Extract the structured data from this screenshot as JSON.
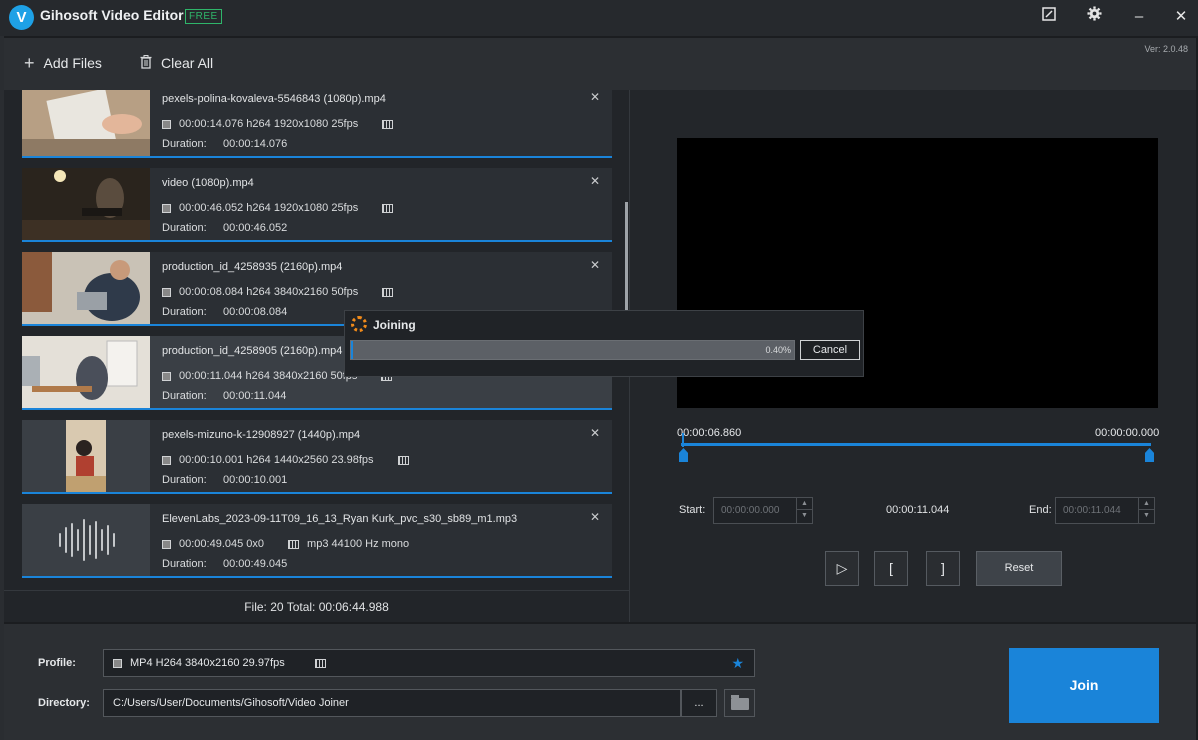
{
  "app": {
    "title": "Gihosoft Video Editor",
    "badge": "FREE",
    "logo": "V"
  },
  "window": {
    "edit_icon": "edit-icon",
    "settings_icon": "gear-icon",
    "minimize": "–",
    "close": "✕"
  },
  "toolbar": {
    "add_files": "Add Files",
    "clear_all": "Clear All",
    "version": "Ver: 2.0.48"
  },
  "files": [
    {
      "name": "pexels-polina-kovaleva-5546843 (1080p).mp4",
      "time": "00:00:14.076",
      "video": "h264 1920x1080 25fps",
      "duration_label": "Duration:",
      "duration": "00:00:14.076",
      "selected": false
    },
    {
      "name": "video (1080p).mp4",
      "time": "00:00:46.052",
      "video": "h264 1920x1080 25fps",
      "duration_label": "Duration:",
      "duration": "00:00:46.052",
      "selected": false
    },
    {
      "name": "production_id_4258935 (2160p).mp4",
      "time": "00:00:08.084",
      "video": "h264 3840x2160 50fps",
      "duration_label": "Duration:",
      "duration": "00:00:08.084",
      "selected": false
    },
    {
      "name": "production_id_4258905 (2160p).mp4",
      "time": "00:00:11.044",
      "video": "h264 3840x2160 50fps",
      "duration_label": "Duration:",
      "duration": "00:00:11.044",
      "selected": true
    },
    {
      "name": "pexels-mizuno-k-12908927 (1440p).mp4",
      "time": "00:00:10.001",
      "video": "h264 1440x2560 23.98fps",
      "duration_label": "Duration:",
      "duration": "00:00:10.001",
      "selected": false
    },
    {
      "name": "ElevenLabs_2023-09-11T09_16_13_Ryan Kurk_pvc_s30_sb89_m1.mp3",
      "time": "00:00:49.045",
      "video": "0x0",
      "audio": "mp3 44100 Hz mono",
      "duration_label": "Duration:",
      "duration": "00:00:49.045",
      "selected": false
    }
  ],
  "status": {
    "text": "File: 20  Total: 00:06:44.988"
  },
  "preview": {
    "time_left": "00:00:06.860",
    "time_right": "00:00:00.000",
    "start_label": "Start:",
    "start_value": "00:00:00.000",
    "middle_time": "00:00:11.044",
    "end_label": "End:",
    "end_value": "00:00:11.044",
    "play": "▷",
    "mark_in": "[",
    "mark_out": "]",
    "reset": "Reset"
  },
  "dialog": {
    "title": "Joining",
    "progress_text": "0.40%",
    "progress": 0.004,
    "cancel": "Cancel"
  },
  "output": {
    "profile_label": "Profile:",
    "profile_value": "MP4 H264 3840x2160 29.97fps",
    "directory_label": "Directory:",
    "directory_value": "C:/Users/User/Documents/Gihosoft/Video Joiner",
    "browse": "...",
    "join": "Join"
  },
  "colors": {
    "accent": "#1a84d9",
    "free_badge": "#2fb56a",
    "spinner": "#f08a1a"
  }
}
